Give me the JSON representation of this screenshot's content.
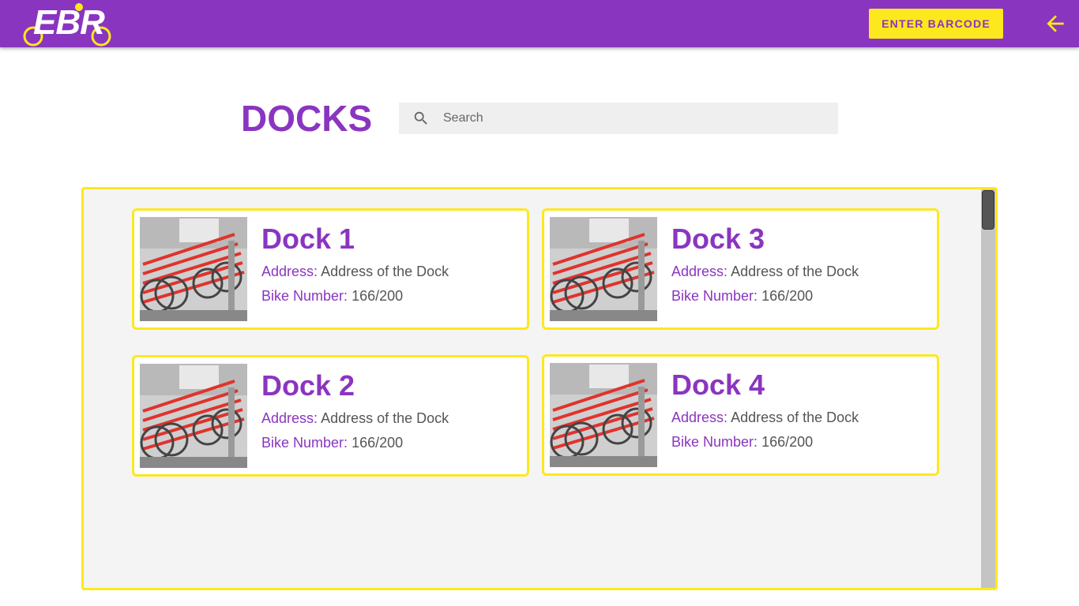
{
  "header": {
    "logo_text": "EBR",
    "barcode_label": "ENTER BARCODE",
    "back_icon": "arrow-left-icon"
  },
  "page": {
    "title": "DOCKS",
    "search_placeholder": "Search",
    "search_value": ""
  },
  "docks": [
    {
      "name": "Dock 1",
      "address_label": "Address:",
      "address": "Address of the Dock",
      "bikes_label": "Bike Number:",
      "bikes": "166/200"
    },
    {
      "name": "Dock 3",
      "address_label": "Address:",
      "address": "Address of the Dock",
      "bikes_label": "Bike Number:",
      "bikes": "166/200"
    },
    {
      "name": "Dock 2",
      "address_label": "Address:",
      "address": "Address of the Dock",
      "bikes_label": "Bike Number:",
      "bikes": "166/200"
    },
    {
      "name": "Dock 4",
      "address_label": "Address:",
      "address": "Address of the Dock",
      "bikes_label": "Bike Number:",
      "bikes": "166/200"
    }
  ],
  "colors": {
    "primary": "#8a35c0",
    "accent": "#fde81d",
    "panel_bg": "#f4f4f4"
  }
}
